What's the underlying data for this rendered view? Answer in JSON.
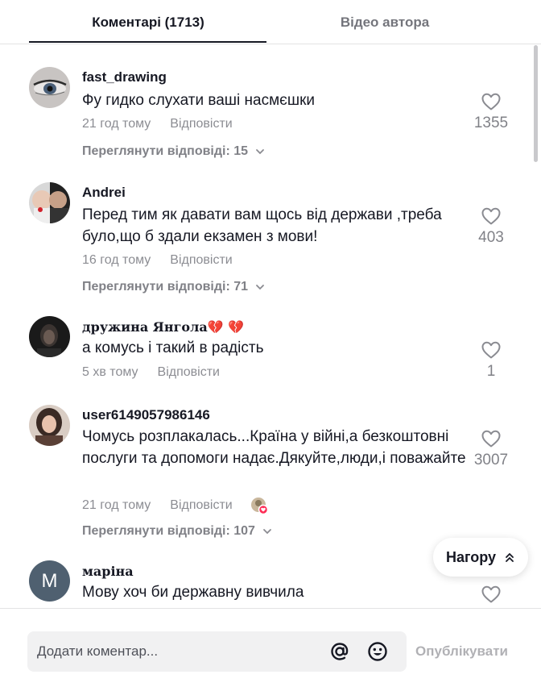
{
  "tabs": {
    "comments": "Коментарі (1713)",
    "author_videos": "Відео автора"
  },
  "comments": [
    {
      "username": "fast_drawing",
      "text": "Фу гидко слухати ваші насмєшки",
      "time": "21 год тому",
      "reply": "Відповісти",
      "likes": "1355",
      "view_replies": "Переглянути відповіді: 15"
    },
    {
      "username": "Andrei",
      "text": "Перед тим як давати вам щось від держави ,треба було,що б здали екзамен з мови!",
      "time": "16 год тому",
      "reply": "Відповісти",
      "likes": "403",
      "view_replies": "Переглянути відповіді: 71"
    },
    {
      "username": "дружина Янгола💔 💔",
      "text": "а комусь і такий в радість",
      "time": "5 хв тому",
      "reply": "Відповісти",
      "likes": "1"
    },
    {
      "username": "user6149057986146",
      "text": "Чомусь розплакалась...Країна у війні,а безкоштовні послуги та допомоги надає.Дякуйте,люди,і поважайте",
      "time": "21 год тому",
      "reply": "Відповісти",
      "likes": "3007",
      "view_replies": "Переглянути відповіді: 107"
    },
    {
      "username": "маріна",
      "avatar_letter": "M",
      "text": "Мову хоч би державну вивчила"
    }
  ],
  "to_top": "Нагору",
  "footer": {
    "placeholder": "Додати коментар...",
    "post": "Опублікувати"
  },
  "icons": {
    "like": "heart-outline-icon",
    "expand": "chevron-down-icon",
    "to_top": "double-chevron-up-icon",
    "mention": "at-icon",
    "emoji": "smiley-icon"
  },
  "colors": {
    "text": "#161823",
    "muted": "#8a8b91",
    "tab_underline": "#161823",
    "heart_badge": "#fe2c55"
  }
}
